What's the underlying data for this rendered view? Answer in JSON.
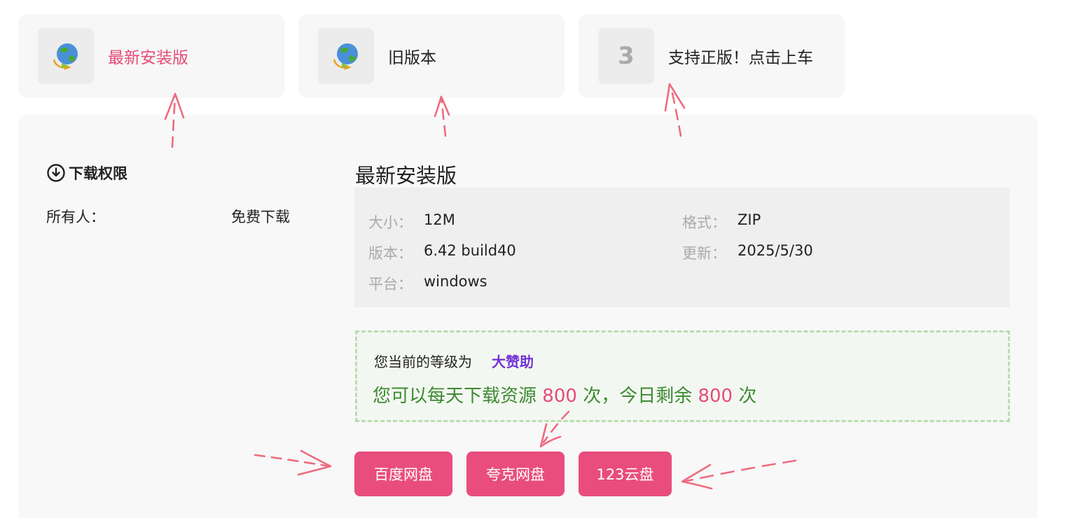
{
  "version_tabs": [
    {
      "label": "最新安装版",
      "icon": "idm-globe-icon",
      "active": true
    },
    {
      "label": "旧版本",
      "icon": "idm-globe-icon",
      "active": false
    },
    {
      "label": "支持正版！点击上车",
      "badge": "3",
      "active": false
    }
  ],
  "permissions": {
    "title": "下载权限",
    "who": "所有人：",
    "value": "免费下载"
  },
  "detail": {
    "title": "最新安装版",
    "size_label": "大小：",
    "size": "12M",
    "format_label": "格式：",
    "format": "ZIP",
    "version_label": "版本：",
    "version": "6.42 build40",
    "updated_label": "更新：",
    "updated": "2025/5/30",
    "platform_label": "平台：",
    "platform": "windows"
  },
  "level": {
    "prefix": "您当前的等级为",
    "name": "大赞助",
    "quota_prefix": "您可以每天下载资源",
    "daily": "800",
    "mid": "次，今日剩余",
    "remaining": "800",
    "suffix": "次"
  },
  "downloads": [
    {
      "label": "百度网盘"
    },
    {
      "label": "夸克网盘"
    },
    {
      "label": "123云盘"
    }
  ],
  "colors": {
    "accent": "#e64c79",
    "button": "#e84d7d",
    "level": "#7232d6",
    "quota": "#3d8a32",
    "arrow": "#ee6b7f"
  }
}
